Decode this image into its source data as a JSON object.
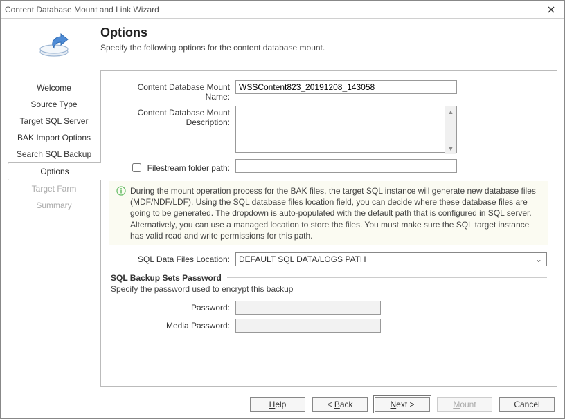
{
  "window": {
    "title": "Content Database Mount and Link Wizard"
  },
  "header": {
    "title": "Options",
    "subtitle": "Specify the following options for the content database mount."
  },
  "sidebar": {
    "items": [
      {
        "label": "Welcome",
        "state": "normal"
      },
      {
        "label": "Source Type",
        "state": "normal"
      },
      {
        "label": "Target SQL Server",
        "state": "normal"
      },
      {
        "label": "BAK Import Options",
        "state": "normal"
      },
      {
        "label": "Search SQL Backup",
        "state": "normal"
      },
      {
        "label": "Options",
        "state": "selected"
      },
      {
        "label": "Target Farm",
        "state": "disabled"
      },
      {
        "label": "Summary",
        "state": "disabled"
      }
    ]
  },
  "form": {
    "mount_name_label": "Content Database Mount Name:",
    "mount_name_value": "WSSContent823_20191208_143058",
    "mount_desc_label": "Content Database Mount Description:",
    "mount_desc_value": "",
    "filestream_checked": false,
    "filestream_label": "Filestream folder path:",
    "filestream_value": "",
    "info_text": "During the mount operation process for the BAK files, the target SQL instance will generate new database files (MDF/NDF/LDF). Using the SQL database files location field, you can decide where these database files are going to be generated. The dropdown is auto-populated with the default path that is configured in SQL server. Alternatively, you can use a managed location to store the files. You must make sure the SQL target instance has valid read and write permissions for this path.",
    "sql_location_label": "SQL Data Files Location:",
    "sql_location_value": "DEFAULT SQL DATA/LOGS PATH",
    "backupsets_title": "SQL Backup Sets Password",
    "backupsets_sub": "Specify the password used to encrypt this backup",
    "password_label": "Password:",
    "password_value": "",
    "media_password_label": "Media Password:",
    "media_password_value": ""
  },
  "footer": {
    "help": "Help",
    "help_u": "H",
    "back": "< Back",
    "back_u": "B",
    "next": "Next >",
    "next_u": "N",
    "mount": "Mount",
    "mount_u": "M",
    "cancel": "Cancel"
  }
}
